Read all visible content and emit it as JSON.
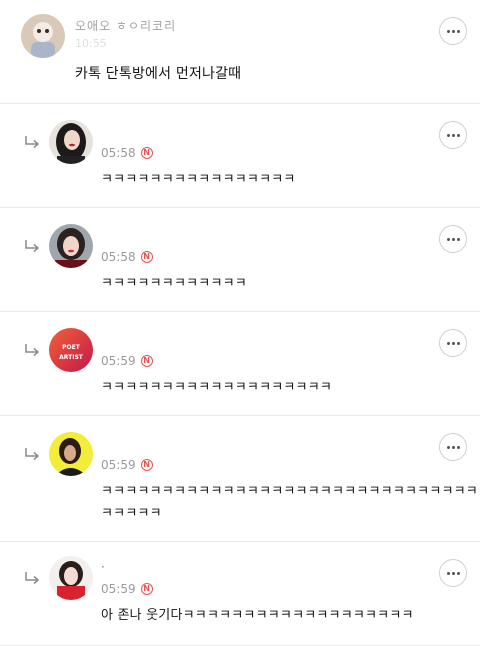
{
  "root_comment": {
    "name": "오애오 ㅎㅇ리코리",
    "time": "10:55",
    "text": "카톡 단톡방에서 먼저나갈때"
  },
  "replies": [
    {
      "time": "05:58",
      "text": "ㅋㅋㅋㅋㅋㅋㅋㅋㅋㅋㅋㅋㅋㅋㅋㅋ"
    },
    {
      "time": "05:58",
      "text": "ㅋㅋㅋㅋㅋㅋㅋㅋㅋㅋㅋㅋ"
    },
    {
      "time": "05:59",
      "text": "ㅋㅋㅋㅋㅋㅋㅋㅋㅋㅋㅋㅋㅋㅋㅋㅋㅋㅋㅋ",
      "avatar_text": [
        "POET",
        "ARTIST"
      ]
    },
    {
      "time": "05:59",
      "text_line1": "ㅋㅋㅋㅋㅋㅋㅋㅋㅋㅋㅋㅋㅋㅋㅋㅋㅋㅋㅋㅋㅋㅋㅋㅋㅋㅋㅋㅋㅋㅋㅋ",
      "text_line2": "ㅋㅋㅋㅋㅋ"
    },
    {
      "name": "·",
      "time": "05:59",
      "text": "아 존나 웃기다ㅋㅋㅋㅋㅋㅋㅋㅋㅋㅋㅋㅋㅋㅋㅋㅋㅋㅋㅋ"
    }
  ],
  "badge_label": "N",
  "icons": {
    "more": "more-horizontal-icon",
    "reply": "reply-arrow-icon",
    "new": "new-badge-icon"
  },
  "colors": {
    "badge": "#e8524f",
    "timestamp": "#9a9a9a",
    "divider": "#e9e9e9"
  }
}
